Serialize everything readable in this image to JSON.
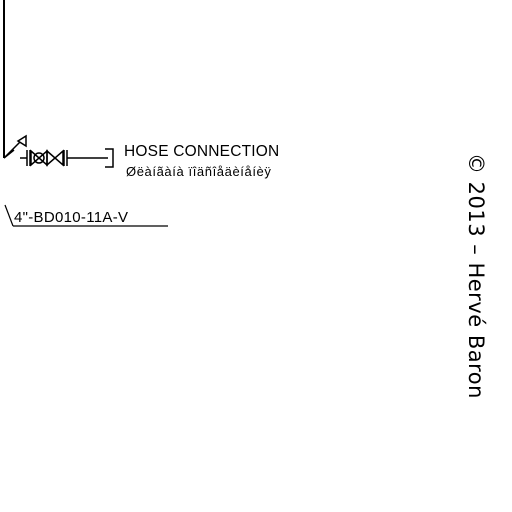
{
  "diagram": {
    "hose_label": "HOSE CONNECTION",
    "hose_sublabel": "Øëàíãàíà ïîäñîåäèíåíèÿ",
    "line_tag": "4\"-BD010-11A-V",
    "copyright": "© 2013 – Hervé Baron",
    "line_color": "#000000",
    "background_color": "#ffffff"
  }
}
